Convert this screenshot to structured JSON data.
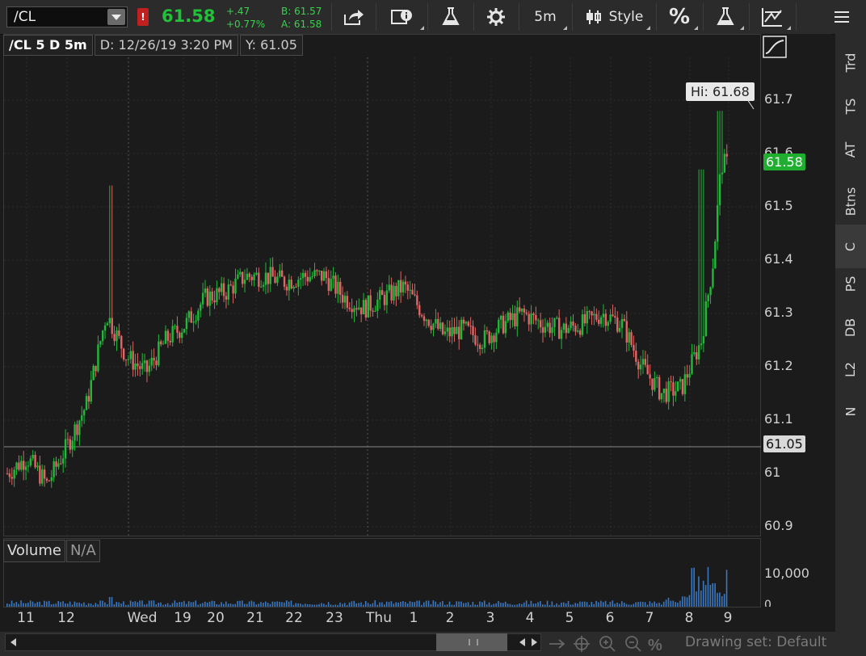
{
  "toolbar": {
    "symbol": "/CL",
    "alert_badge": "!",
    "last_price": "61.58",
    "change": "+.47",
    "change_pct": "+0.77%",
    "bid": "B: 61.57",
    "ask": "A: 61.58",
    "timeframe": "5m",
    "style_label": "Style",
    "percent_label": "%"
  },
  "chart_header": {
    "title": "/CL 5 D 5m",
    "date_readout": "D: 12/26/19 3:20 PM",
    "y_readout": "Y: 61.05"
  },
  "price_axis": {
    "ticks": [
      "61.7",
      "61.6",
      "61.5",
      "61.4",
      "61.3",
      "61.2",
      "61.1",
      "61",
      "60.9"
    ],
    "last_label": "61.58",
    "crosshair_label": "61.05",
    "hi_label": "Hi: 61.68"
  },
  "volume": {
    "title": "Volume",
    "value": "N/A",
    "ticks": [
      "10,000",
      "0"
    ]
  },
  "time_axis": {
    "ticks": [
      "11",
      "12",
      "Wed",
      "19",
      "20",
      "21",
      "22",
      "23",
      "Thu",
      "1",
      "2",
      "3",
      "4",
      "5",
      "6",
      "7",
      "8",
      "9"
    ]
  },
  "right_tabs": [
    "Trd",
    "TS",
    "AT",
    "Btns",
    "C",
    "PS",
    "DB",
    "L2",
    "N"
  ],
  "bottom": {
    "drawing_set": "Drawing set: Default"
  },
  "colors": {
    "up": "#22b83a",
    "down": "#e06565",
    "accent_green": "#21c13a"
  },
  "chart_data": {
    "type": "candlestick",
    "symbol": "/CL",
    "interval": "5m",
    "ylim": [
      60.88,
      61.78
    ],
    "x_categories": [
      "11",
      "12",
      "Wed",
      "19",
      "20",
      "21",
      "22",
      "23",
      "Thu",
      "1",
      "2",
      "3",
      "4",
      "5",
      "6",
      "7",
      "8",
      "9"
    ],
    "hi": 61.68,
    "last": 61.58,
    "crosshair_y": 61.05,
    "approx_close_path": [
      [
        0,
        61.0
      ],
      [
        0.5,
        61.03
      ],
      [
        1,
        60.98
      ],
      [
        1.5,
        61.05
      ],
      [
        2,
        61.13
      ],
      [
        2.5,
        61.3
      ],
      [
        3,
        61.22
      ],
      [
        3.5,
        61.19
      ],
      [
        4,
        61.25
      ],
      [
        4.5,
        61.28
      ],
      [
        5,
        61.33
      ],
      [
        5.5,
        61.34
      ],
      [
        6,
        61.37
      ],
      [
        6.5,
        61.37
      ],
      [
        7,
        61.36
      ],
      [
        7.5,
        61.37
      ],
      [
        8,
        61.37
      ],
      [
        8.5,
        61.33
      ],
      [
        9,
        61.31
      ],
      [
        9.5,
        61.33
      ],
      [
        10,
        61.35
      ],
      [
        10.5,
        61.3
      ],
      [
        11,
        61.26
      ],
      [
        11.5,
        61.27
      ],
      [
        12,
        61.25
      ],
      [
        12.5,
        61.28
      ],
      [
        13,
        61.3
      ],
      [
        13.5,
        61.28
      ],
      [
        14,
        61.27
      ],
      [
        14.5,
        61.28
      ],
      [
        15,
        61.3
      ],
      [
        15.5,
        61.28
      ],
      [
        16,
        61.2
      ],
      [
        16.5,
        61.15
      ],
      [
        17,
        61.16
      ],
      [
        17.5,
        61.25
      ],
      [
        17.8,
        61.4
      ],
      [
        18,
        61.58
      ]
    ]
  }
}
